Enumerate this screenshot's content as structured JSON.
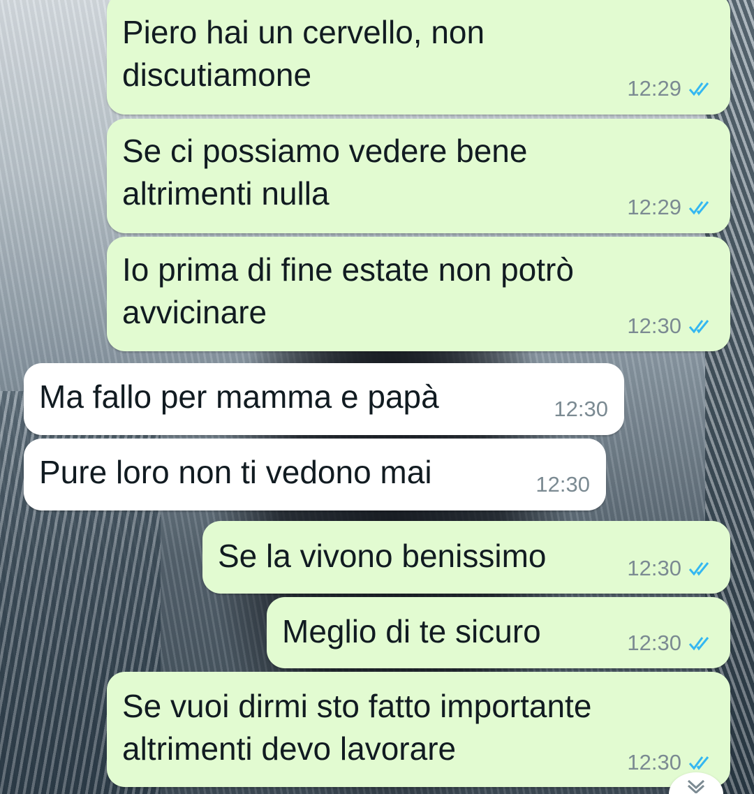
{
  "conversation": {
    "messages": [
      {
        "direction": "outgoing",
        "text": "Piero hai un cervello, non\ndiscutiamone",
        "time": "12:29",
        "status": "read"
      },
      {
        "direction": "outgoing",
        "text": "Se ci possiamo vedere bene\naltrimenti nulla",
        "time": "12:29",
        "status": "read"
      },
      {
        "direction": "outgoing",
        "text": "Io prima di fine estate non potrò\navvicinare",
        "time": "12:30",
        "status": "read"
      },
      {
        "direction": "incoming",
        "text": "Ma fallo per mamma e papà",
        "time": "12:30"
      },
      {
        "direction": "incoming",
        "text": "Pure loro non ti vedono mai",
        "time": "12:30"
      },
      {
        "direction": "outgoing",
        "text": "Se la vivono benissimo",
        "time": "12:30",
        "status": "read"
      },
      {
        "direction": "outgoing",
        "text": "Meglio di te sicuro",
        "time": "12:30",
        "status": "read"
      },
      {
        "direction": "outgoing",
        "text": "Se vuoi dirmi sto fatto importante\naltrimenti devo lavorare",
        "time": "12:30",
        "status": "read"
      }
    ]
  },
  "icons": {
    "read_receipt": "double-check-icon",
    "scroll_down": "chevron-double-down-icon"
  },
  "colors": {
    "outgoing_bubble": "#e2fbd1",
    "incoming_bubble": "#ffffff",
    "read_tick": "#34b7f1",
    "timestamp": "#7b8a92",
    "message_text": "#111b21"
  }
}
